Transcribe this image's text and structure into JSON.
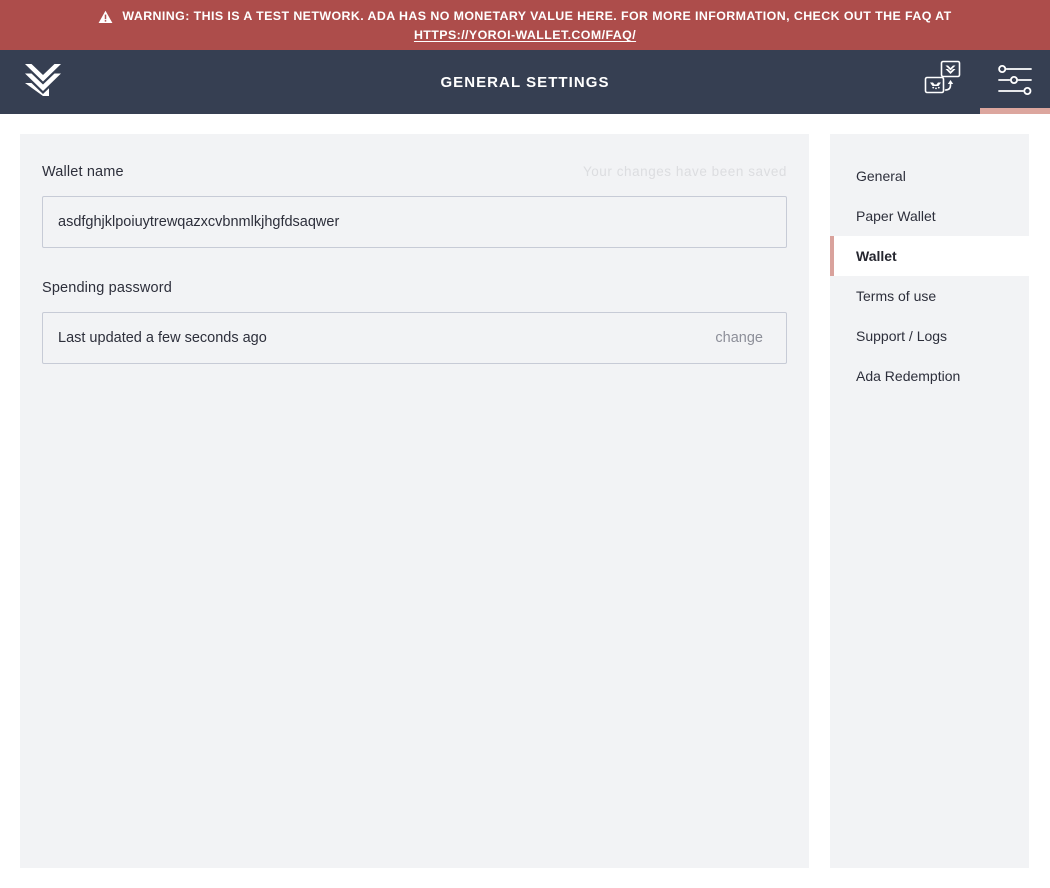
{
  "banner": {
    "icon": "warning-triangle-icon",
    "text": "WARNING: THIS IS A TEST NETWORK. ADA HAS NO MONETARY VALUE HERE. FOR MORE INFORMATION, CHECK OUT THE FAQ AT",
    "link_text": "HTTPS://YOROI-WALLET.COM/FAQ/",
    "bg_color": "#ad4d4b"
  },
  "navbar": {
    "logo": "yoroi-logo-icon",
    "title": "GENERAL SETTINGS",
    "bg_color": "#363f52",
    "actions": [
      {
        "name": "wallet-switcher-icon",
        "active": false
      },
      {
        "name": "settings-sliders-icon",
        "active": true
      }
    ],
    "active_indicator_color": "#dca69e"
  },
  "settings_form": {
    "wallet_name": {
      "label": "Wallet name",
      "value": "asdfghjklpoiuytrewqazxcvbnmlkjhgfdsaqwer",
      "placeholder": "Wallet name",
      "saved_message": "Your changes have been saved"
    },
    "spending_password": {
      "label": "Spending password",
      "status": "Last updated a few seconds ago",
      "change_label": "change"
    }
  },
  "settings_menu": {
    "items": [
      {
        "label": "General",
        "active": false
      },
      {
        "label": "Paper Wallet",
        "active": false
      },
      {
        "label": "Wallet",
        "active": true
      },
      {
        "label": "Terms of use",
        "active": false
      },
      {
        "label": "Support / Logs",
        "active": false
      },
      {
        "label": "Ada Redemption",
        "active": false
      }
    ],
    "active_border_color": "#d9a29c"
  }
}
